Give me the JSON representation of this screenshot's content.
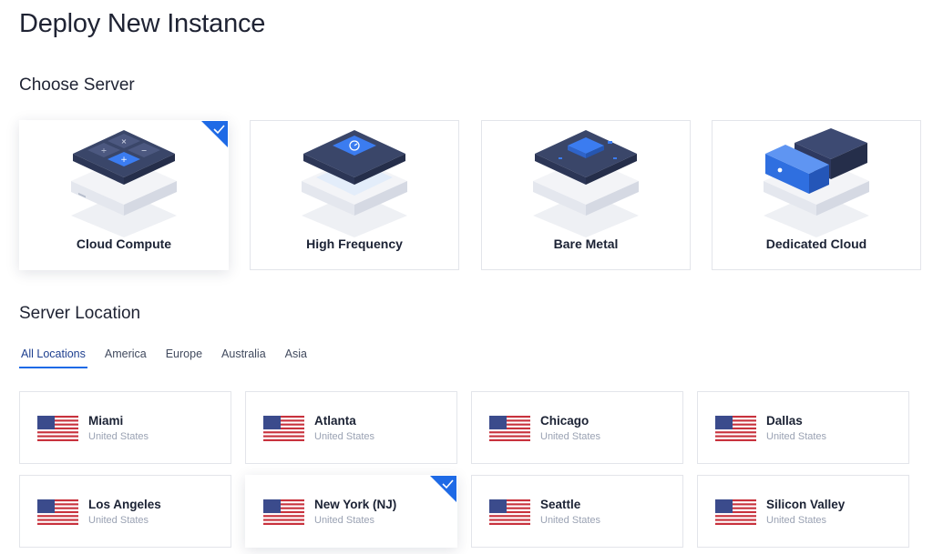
{
  "page": {
    "title": "Deploy New Instance"
  },
  "choose_server": {
    "title": "Choose Server",
    "selected": "Cloud Compute",
    "options": [
      {
        "id": "cloud-compute",
        "label": "Cloud Compute",
        "icon": "cloud-compute-icon"
      },
      {
        "id": "high-frequency",
        "label": "High Frequency",
        "icon": "high-frequency-icon"
      },
      {
        "id": "bare-metal",
        "label": "Bare Metal",
        "icon": "bare-metal-icon"
      },
      {
        "id": "dedicated-cloud",
        "label": "Dedicated Cloud",
        "icon": "dedicated-cloud-icon"
      }
    ]
  },
  "server_location": {
    "title": "Server Location",
    "tabs": [
      "All Locations",
      "America",
      "Europe",
      "Australia",
      "Asia"
    ],
    "active_tab": "All Locations",
    "selected": "New York (NJ)",
    "locations": [
      {
        "city": "Miami",
        "country": "United States",
        "flag": "us-flag-icon"
      },
      {
        "city": "Atlanta",
        "country": "United States",
        "flag": "us-flag-icon"
      },
      {
        "city": "Chicago",
        "country": "United States",
        "flag": "us-flag-icon"
      },
      {
        "city": "Dallas",
        "country": "United States",
        "flag": "us-flag-icon"
      },
      {
        "city": "Los Angeles",
        "country": "United States",
        "flag": "us-flag-icon"
      },
      {
        "city": "New York (NJ)",
        "country": "United States",
        "flag": "us-flag-icon"
      },
      {
        "city": "Seattle",
        "country": "United States",
        "flag": "us-flag-icon"
      },
      {
        "city": "Silicon Valley",
        "country": "United States",
        "flag": "us-flag-icon"
      }
    ]
  },
  "colors": {
    "accent": "#1e6ae6",
    "text": "#1b2234",
    "muted": "#9aa2b3",
    "border": "#e3e5ea",
    "flag_red": "#c8323d",
    "flag_blue": "#3b4b8c"
  }
}
